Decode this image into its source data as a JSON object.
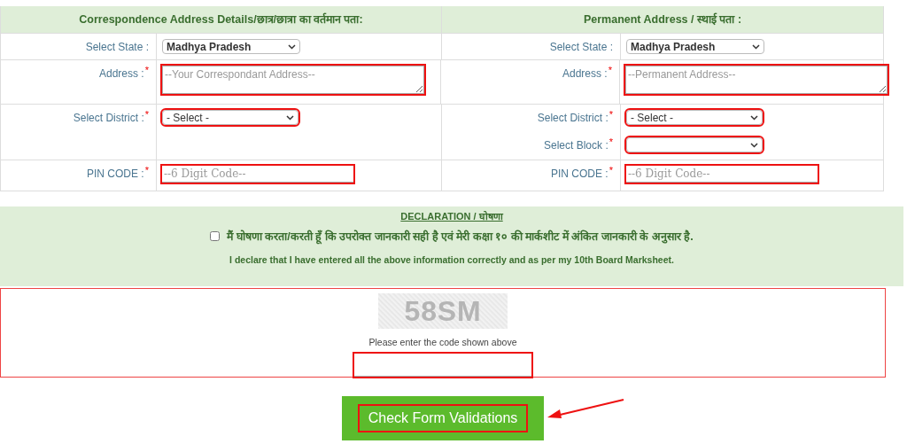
{
  "address_columns": [
    {
      "heading": "Correspondence Address Details/छात्र/छात्रा का वर्तमान पता:",
      "rows": [
        [
          {
            "label": "Select State :",
            "kind": "select",
            "value": "Madhya Pradesh",
            "highlighted": false
          }
        ],
        [
          {
            "label": "Address :",
            "required_mark": "*",
            "kind": "textarea",
            "placeholder": "--Your Correspondant Address--",
            "highlighted": true
          }
        ],
        [
          {
            "label": "Select District :",
            "required_mark": "*",
            "kind": "select",
            "value": "- Select -",
            "highlighted": true
          }
        ],
        [
          {
            "label": "PIN CODE :",
            "required_mark": "*",
            "kind": "input",
            "placeholder": "--6 Digit Code--",
            "highlighted": true
          }
        ]
      ]
    },
    {
      "heading": "Permanent Address / स्थाई पता :",
      "rows": [
        [
          {
            "label": "Select State :",
            "kind": "select",
            "value": "Madhya Pradesh",
            "highlighted": false
          }
        ],
        [
          {
            "label": "Address :",
            "required_mark": "*",
            "kind": "textarea",
            "placeholder": "--Permanent Address--",
            "highlighted": true
          }
        ],
        [
          {
            "label": "Select District :",
            "required_mark": "*",
            "kind": "select",
            "value": "- Select -",
            "highlighted": true
          },
          {
            "label": "Select Block :",
            "required_mark": "*",
            "kind": "select",
            "highlighted": true
          }
        ],
        [
          {
            "label": "PIN CODE :",
            "required_mark": "*",
            "kind": "input",
            "placeholder": "--6 Digit Code--",
            "highlighted": true
          }
        ]
      ]
    }
  ],
  "declaration": {
    "title": "DECLARATION / घोषणा",
    "checked": false,
    "statement_hindi": "मैं घोषणा करता/करती हूँ कि उपरोक्त जानकारी सही है एवं मेरी कक्षा १० की मार्कशीट में अंकित जानकारी के अनुसार है.",
    "statement_english": "I declare that I have entered all the above information correctly and as per my 10th Board Marksheet."
  },
  "captcha": {
    "code": "58SM",
    "prompt": "Please enter the code shown above",
    "highlighted": true
  },
  "submit_button": {
    "label": "Check Form Validations",
    "highlighted": true
  }
}
